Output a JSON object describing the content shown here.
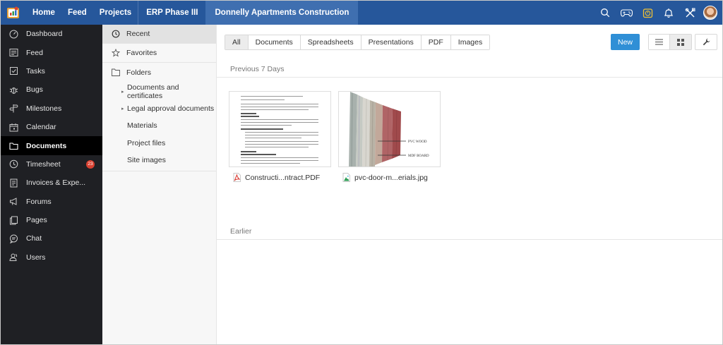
{
  "app": {
    "logo_icon": "zoho-projects-logo-icon"
  },
  "topnav": {
    "items": [
      {
        "label": "Home"
      },
      {
        "label": "Feed"
      },
      {
        "label": "Projects"
      },
      {
        "label": "ERP Phase III"
      },
      {
        "label": "Donnelly Apartments Construction"
      }
    ],
    "icons": [
      "search-icon",
      "gamepad-icon",
      "timer-icon",
      "bell-icon",
      "tools-icon",
      "avatar"
    ]
  },
  "sidebar": {
    "items": [
      {
        "label": "Dashboard",
        "icon": "dashboard-icon"
      },
      {
        "label": "Feed",
        "icon": "feed-icon"
      },
      {
        "label": "Tasks",
        "icon": "tasks-icon"
      },
      {
        "label": "Bugs",
        "icon": "bug-icon"
      },
      {
        "label": "Milestones",
        "icon": "milestone-icon"
      },
      {
        "label": "Calendar",
        "icon": "calendar-icon"
      },
      {
        "label": "Documents",
        "icon": "folder-icon",
        "active": true
      },
      {
        "label": "Timesheet",
        "icon": "clock-icon",
        "badge": "23"
      },
      {
        "label": "Invoices & Expe...",
        "icon": "invoice-icon"
      },
      {
        "label": "Forums",
        "icon": "megaphone-icon"
      },
      {
        "label": "Pages",
        "icon": "pages-icon"
      },
      {
        "label": "Chat",
        "icon": "chat-icon"
      },
      {
        "label": "Users",
        "icon": "users-icon"
      }
    ]
  },
  "folders": {
    "recent": "Recent",
    "favorites": "Favorites",
    "folders": "Folders",
    "subfolders": [
      {
        "label": "Documents and certificates",
        "has_children": true
      },
      {
        "label": "Legal approval documents",
        "has_children": true
      },
      {
        "label": "Materials",
        "has_children": false
      },
      {
        "label": "Project files",
        "has_children": false
      },
      {
        "label": "Site images",
        "has_children": false
      }
    ]
  },
  "main": {
    "filters": [
      "All",
      "Documents",
      "Spreadsheets",
      "Presentations",
      "PDF",
      "Images"
    ],
    "new_label": "New",
    "section_recent": "Previous 7 Days",
    "section_earlier": "Earlier",
    "files": [
      {
        "name": "Constructi...ntract.PDF",
        "icon": "pdf-file-icon"
      },
      {
        "name": "pvc-door-m...erials.jpg",
        "icon": "image-file-icon"
      }
    ],
    "door_labels": [
      "PVC WOOD",
      "MDF BOARD"
    ]
  },
  "colors": {
    "topbar": "#26579b",
    "topbar_active": "#3f6fb0",
    "sidebar": "#1f2024",
    "accent": "#2f8fd6",
    "badge": "#d94232"
  }
}
